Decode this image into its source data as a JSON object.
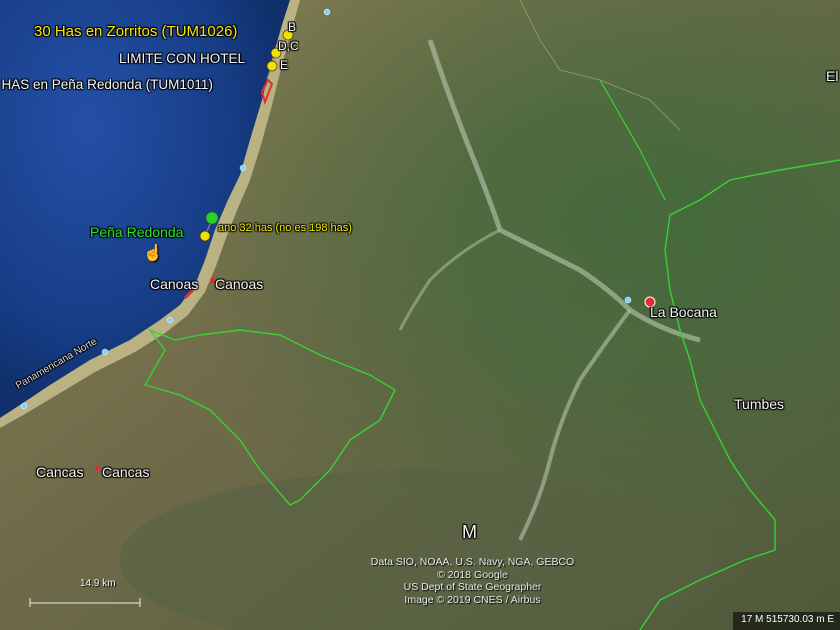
{
  "labels": {
    "zorritos": "30 Has en Zorritos (TUM1026)",
    "limite_hotel": "LIMITE CON HOTEL",
    "pena_redonda_has": "HAS en Peña Redonda (TUM1011)",
    "pena_redonda": "Peña Redonda",
    "plano_note": "ano 32 has (no es 198 has)",
    "canoas_1": "Canoas",
    "canoas_2": "Canoas",
    "cancas_1": "Cancas",
    "cancas_2": "Cancas",
    "la_bocana": "La Bocana",
    "tumbes": "Tumbes",
    "panamericana": "Panamericana Norte",
    "region_m": "M",
    "edge_label": "El",
    "marker_b": "B",
    "marker_dc": "D,C",
    "marker_e": "E"
  },
  "attribution": {
    "line1": "Data SIO, NOAA, U.S. Navy, NGA, GEBCO",
    "line2": "© 2018 Google",
    "line3": "US Dept of State Geographer",
    "line4": "Image © 2019 CNES / Airbus"
  },
  "scale": {
    "label": "14.9 km"
  },
  "status_bar": {
    "coords": "17 M 515730.03 m E"
  },
  "colors": {
    "ocean": "#1d3f86",
    "land": "#6f6a48",
    "boundary": "#37d137",
    "placemark_yellow": "#f1e000",
    "placemark_green": "#2bd12b",
    "marker_red": "#e03030"
  },
  "icons": [
    "hand-cursor-icon",
    "yellow-pushpin-icon",
    "green-pushpin-icon",
    "red-location-pin-icon"
  ]
}
